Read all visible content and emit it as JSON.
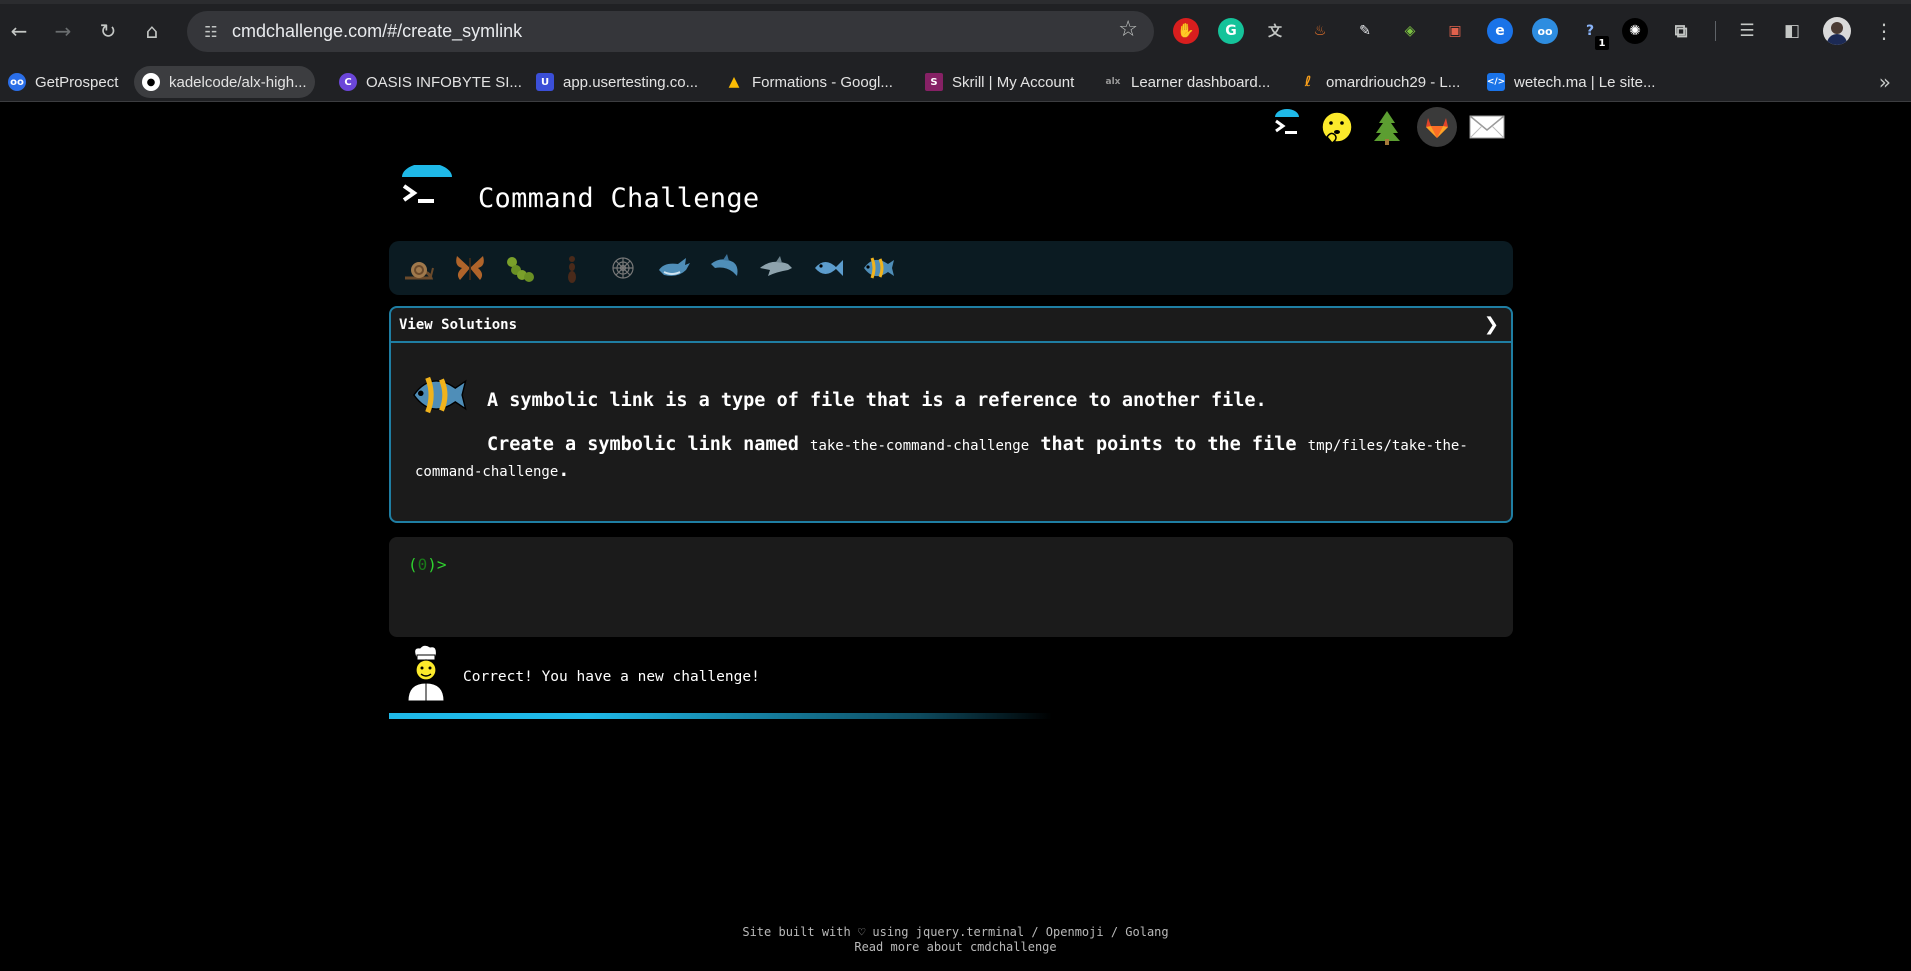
{
  "browser": {
    "url_host": "cmdchallenge.com",
    "url_path": "/#/create_symlink",
    "extension_badge": "1",
    "bookmarks": [
      {
        "label": "GetProspect",
        "icon": "getprospect-icon",
        "color": "#2a6ee8"
      },
      {
        "label": "kadelcode/alx-high...",
        "icon": "github-icon",
        "color": "#ffffff"
      },
      {
        "label": "OASIS INFOBYTE SI...",
        "icon": "oasis-icon",
        "color": "#6b46d9"
      },
      {
        "label": "app.usertesting.co...",
        "icon": "usertesting-icon",
        "color": "#3b4fd8"
      },
      {
        "label": "Formations - Googl...",
        "icon": "google-drive-icon",
        "color": "#34a853"
      },
      {
        "label": "Skrill | My Account",
        "icon": "skrill-icon",
        "color": "#862165"
      },
      {
        "label": "Learner dashboard...",
        "icon": "alx-icon",
        "color": "#555555"
      },
      {
        "label": "omardriouch29 - L...",
        "icon": "leetcode-icon",
        "color": "#f89f1b"
      },
      {
        "label": "wetech.ma | Le site...",
        "icon": "wetech-icon",
        "color": "#1a73e8"
      }
    ]
  },
  "site": {
    "title": "Command Challenge"
  },
  "solutions": {
    "header": "View Solutions",
    "chevron": "❯"
  },
  "challenge": {
    "line1": "A symbolic link is a type of file that is a reference to another file.",
    "line2_before": "Create a symbolic link named",
    "link_name": "take-the-command-challenge",
    "line2_middle": "that points to the file",
    "target_path": "tmp/files/take-the-command-challenge",
    "line2_end": "."
  },
  "terminal": {
    "prompt_open": "(",
    "prompt_count": "0",
    "prompt_close": ")>"
  },
  "feedback": {
    "message": "Correct! You have a new challenge!"
  },
  "progress": {
    "fraction": 0.59
  },
  "footer": {
    "line1": "Site built with ♡ using jquery.terminal / Openmoji / Golang",
    "line2": "Read more about cmdchallenge"
  },
  "colors": {
    "accent": "#1f7ea3",
    "progress": "#1fb9e8",
    "prompt": "#2fd02f"
  }
}
